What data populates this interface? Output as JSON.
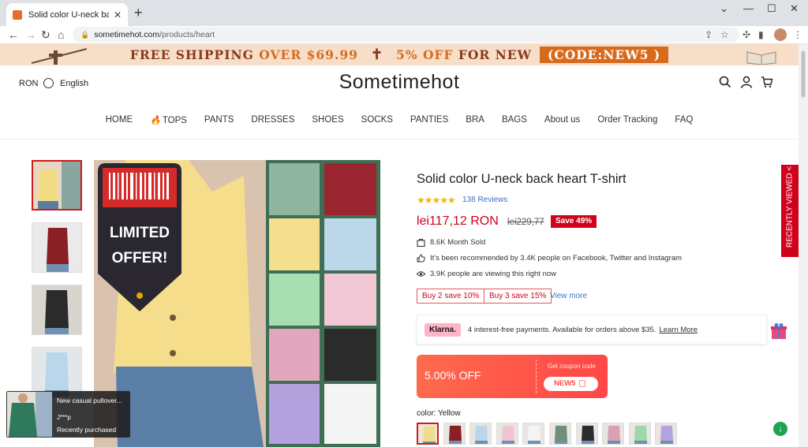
{
  "browser": {
    "tab_title": "Solid color U-neck back heart T-shirt",
    "new_tab": "+",
    "url_host": "sometimehot.com",
    "url_path": "/products/heart"
  },
  "promo": {
    "part1": "FREE SHIPPING",
    "part2": "OVER $69.99",
    "part3": "5% OFF",
    "part4": "FOR NEW",
    "code": "(CODE:NEW5 )"
  },
  "header": {
    "currency": "RON",
    "language": "English",
    "logo": "Sometimehot"
  },
  "menu": {
    "home": "HOME",
    "tops": "TOPS",
    "pants": "PANTS",
    "dresses": "DRESSES",
    "shoes": "SHOES",
    "socks": "SOCKS",
    "panties": "PANTIES",
    "bra": "BRA",
    "bags": "BAGS",
    "about": "About us",
    "tracking": "Order Tracking",
    "faq": "FAQ"
  },
  "gallery": {
    "offer_line1": "LIMITED",
    "offer_line2": "OFFER!",
    "thumb_colors": [
      "#f2dc86",
      "#8a1f24",
      "#2b2b2b",
      "#b9d6ea"
    ]
  },
  "product": {
    "title": "Solid color U-neck back heart T-shirt",
    "rating": 5,
    "stars": "★★★★★",
    "reviews": "138 Reviews",
    "price": "lei117,12 RON",
    "old_price": "lei229,77",
    "save": "Save 49%",
    "sold": "8.6K Month Sold",
    "recommended": "It's been recommended by 3.4K people on Facebook, Twitter and Instagram",
    "viewing": "3.9K people are viewing this right now",
    "bundle1": "Buy 2 save 10%",
    "bundle2": "Buy 3 save 15%",
    "view_more": "View more",
    "klarna_logo": "Klarna.",
    "klarna_text": "4 interest-free payments. Available for orders above $35.",
    "klarna_link": "Learn More",
    "coupon_off": "5.00% OFF",
    "coupon_get": "Get coupon code",
    "coupon_code": "NEW5",
    "color_label": "color: Yellow",
    "swatches": [
      "#f2dc86",
      "#8a1f24",
      "#b9d6ea",
      "#f0c5d0",
      "#f4f4f4",
      "#6f8f7a",
      "#2b2b2b",
      "#d9a0b4",
      "#9fd8a8",
      "#b3a3dc"
    ]
  },
  "side": {
    "recently_viewed": "RECENTLY VIEWED",
    "chevron": "<"
  },
  "popup": {
    "product": "New casual pullover...",
    "buyer": "J***p",
    "status": "Recently purchased"
  }
}
